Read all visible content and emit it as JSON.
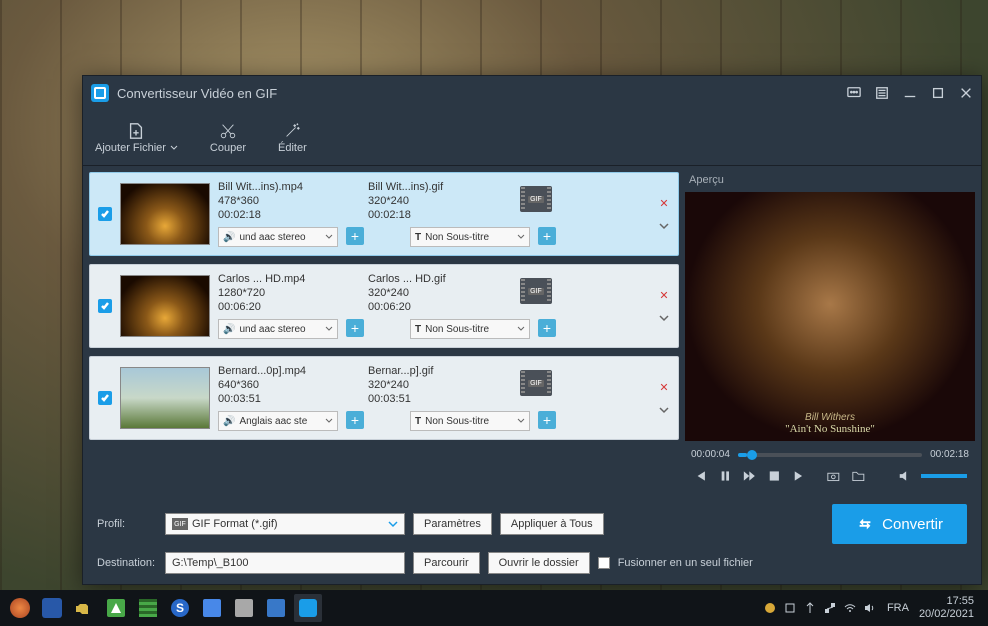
{
  "titlebar": {
    "title": "Convertisseur Vidéo en GIF"
  },
  "toolbar": {
    "add": "Ajouter Fichier",
    "cut": "Couper",
    "edit": "Éditer"
  },
  "files": [
    {
      "src_name": "Bill Wit...ins).mp4",
      "src_res": "478*360",
      "src_dur": "00:02:18",
      "out_name": "Bill Wit...ins).gif",
      "out_res": "320*240",
      "out_dur": "00:02:18",
      "audio": "und aac stereo",
      "subtitle": "Non Sous-titre",
      "selected": true,
      "thumb": "stage"
    },
    {
      "src_name": "Carlos ... HD.mp4",
      "src_res": "1280*720",
      "src_dur": "00:06:20",
      "out_name": "Carlos ... HD.gif",
      "out_res": "320*240",
      "out_dur": "00:06:20",
      "audio": "und aac stereo",
      "subtitle": "Non Sous-titre",
      "selected": false,
      "thumb": "stage"
    },
    {
      "src_name": "Bernard...0p].mp4",
      "src_res": "640*360",
      "src_dur": "00:03:51",
      "out_name": "Bernar...p].gif",
      "out_res": "320*240",
      "out_dur": "00:03:51",
      "audio": "Anglais aac ste",
      "subtitle": "Non Sous-titre",
      "selected": false,
      "thumb": "dome"
    }
  ],
  "preview": {
    "label": "Aperçu",
    "time_cur": "00:00:04",
    "time_total": "00:02:18",
    "caption1": "Bill Withers",
    "caption2": "\"Ain't No Sunshine\""
  },
  "bottom": {
    "profile_label": "Profil:",
    "profile_value": "GIF Format (*.gif)",
    "settings": "Paramètres",
    "apply_all": "Appliquer à Tous",
    "dest_label": "Destination:",
    "dest_value": "G:\\Temp\\_B100",
    "browse": "Parcourir",
    "open_folder": "Ouvrir le dossier",
    "merge": "Fusionner en un seul fichier",
    "convert": "Convertir"
  },
  "taskbar": {
    "lang": "FRA",
    "time": "17:55",
    "date": "20/02/2021"
  },
  "icons": {
    "gif_badge": "GIF",
    "speaker_prefix": "🔊",
    "text_prefix": "T"
  }
}
